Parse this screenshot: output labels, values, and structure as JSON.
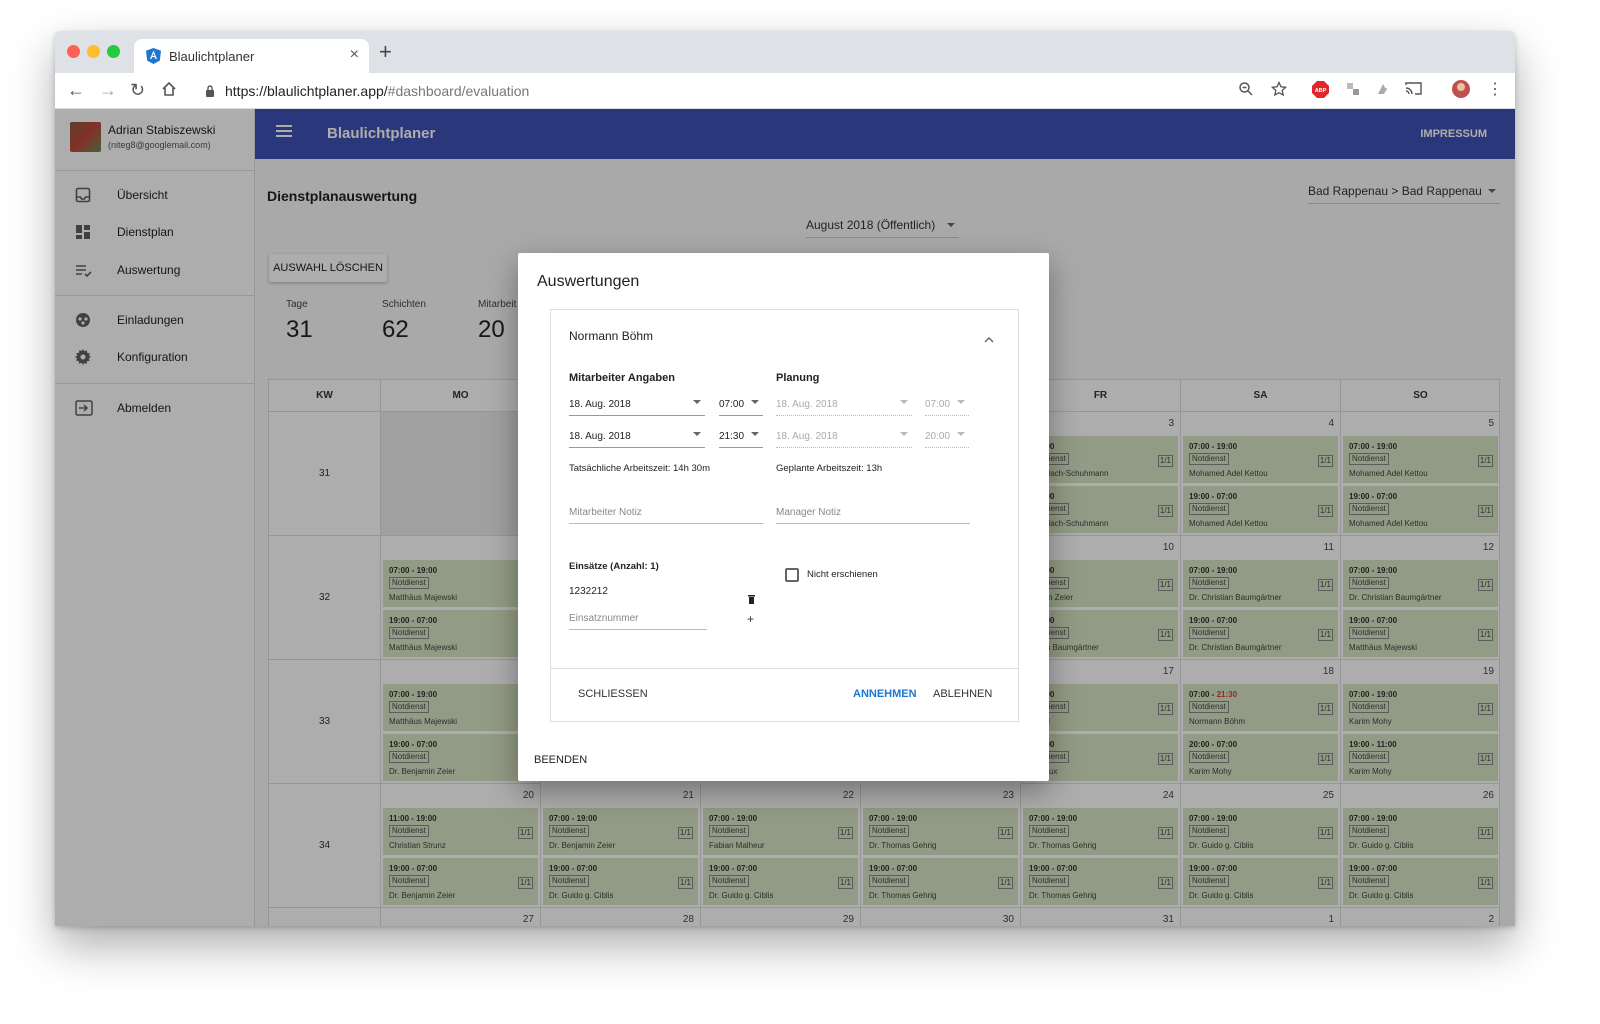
{
  "browser": {
    "tab_title": "Blaulichtplaner",
    "url_host": "https://blaulichtplaner.app/",
    "url_path": "#dashboard/evaluation",
    "new_tab": "+"
  },
  "user": {
    "name": "Adrian Stabiszewski",
    "email": "(niteg8@googlemail.com)"
  },
  "sidebar": {
    "items": [
      {
        "label": "Übersicht",
        "icon": "inbox-icon"
      },
      {
        "label": "Dienstplan",
        "icon": "dashboard-icon"
      },
      {
        "label": "Auswertung",
        "icon": "checklist-icon"
      },
      {
        "label": "Einladungen",
        "icon": "invitations-icon"
      },
      {
        "label": "Konfiguration",
        "icon": "gear-icon"
      },
      {
        "label": "Abmelden",
        "icon": "logout-icon"
      }
    ]
  },
  "appbar": {
    "title": "Blaulichtplaner",
    "impressum": "IMPRESSUM"
  },
  "page": {
    "title": "Dienstplanauswertung",
    "location": "Bad Rappenau > Bad Rappenau",
    "month": "August 2018 (Öffentlich)",
    "clear_button": "AUSWAHL LÖSCHEN",
    "stats": [
      {
        "label": "Tage",
        "value": "31"
      },
      {
        "label": "Schichten",
        "value": "62"
      },
      {
        "label": "Mitarbeit",
        "value": "20"
      }
    ]
  },
  "calendar": {
    "headers": [
      "KW",
      "MO",
      "FR",
      "SA",
      "SO"
    ],
    "weeks": [
      {
        "kw": "31",
        "mo": {
          "day": "",
          "shifts": []
        },
        "fr": {
          "day": "3",
          "shifts": [
            {
              "time": "- 19:00",
              "badge": "Notdienst",
              "count": "1/1",
              "name": "ix Vatlach-Schuhmann"
            },
            {
              "time": "- 07:00",
              "badge": "Notdienst",
              "count": "1/1",
              "name": "ix Vatlach-Schuhmann"
            }
          ]
        },
        "sa": {
          "day": "4",
          "shifts": [
            {
              "time": "07:00 - 19:00",
              "badge": "Notdienst",
              "count": "1/1",
              "name": "Mohamed Adel Kettou"
            },
            {
              "time": "19:00 - 07:00",
              "badge": "Notdienst",
              "count": "1/1",
              "name": "Mohamed Adel Kettou"
            }
          ]
        },
        "so": {
          "day": "5",
          "shifts": [
            {
              "time": "07:00 - 19:00",
              "badge": "Notdienst",
              "count": "1/1",
              "name": "Mohamed Adel Kettou"
            },
            {
              "time": "19:00 - 07:00",
              "badge": "Notdienst",
              "count": "1/1",
              "name": "Mohamed Adel Kettou"
            }
          ]
        }
      },
      {
        "kw": "32",
        "mo": {
          "day": "",
          "shifts": [
            {
              "time": "07:00 - 19:00",
              "badge": "Notdienst",
              "count": "1/1",
              "name": "Matthäus Majewski"
            },
            {
              "time": "19:00 - 07:00",
              "badge": "Notdienst",
              "count": "1/1",
              "name": "Matthäus Majewski"
            }
          ]
        },
        "fr": {
          "day": "10",
          "shifts": [
            {
              "time": "- 19:00",
              "badge": "Notdienst",
              "count": "1/1",
              "name": "njamin Zeier"
            },
            {
              "time": "- 07:00",
              "badge": "Notdienst",
              "count": "1/1",
              "name": "ristian Baumgärtner"
            }
          ]
        },
        "sa": {
          "day": "11",
          "shifts": [
            {
              "time": "07:00 - 19:00",
              "badge": "Notdienst",
              "count": "1/1",
              "name": "Dr. Christian Baumgärtner"
            },
            {
              "time": "19:00 - 07:00",
              "badge": "Notdienst",
              "count": "1/1",
              "name": "Dr. Christian Baumgärtner"
            }
          ]
        },
        "so": {
          "day": "12",
          "shifts": [
            {
              "time": "07:00 - 19:00",
              "badge": "Notdienst",
              "count": "1/1",
              "name": "Dr. Christian Baumgärtner"
            },
            {
              "time": "19:00 - 07:00",
              "badge": "Notdienst",
              "count": "1/1",
              "name": "Matthäus Majewski"
            }
          ]
        }
      },
      {
        "kw": "33",
        "mo": {
          "day": "",
          "shifts": [
            {
              "time": "07:00 - 19:00",
              "badge": "Notdienst",
              "count": "1/1",
              "name": "Matthäus Majewski"
            },
            {
              "time": "19:00 - 07:00",
              "badge": "Notdienst",
              "count": "1/1",
              "name": "Dr. Benjamin Zeier"
            }
          ]
        },
        "fr": {
          "day": "17",
          "shifts": [
            {
              "time": "- 19:00",
              "badge": "Notdienst",
              "count": "1/1",
              "name": "Hubel"
            },
            {
              "time": "- 07:00",
              "badge": "Notdienst",
              "count": "1/1",
              "name": "mut Lux"
            }
          ]
        },
        "sa": {
          "day": "18",
          "shifts": [
            {
              "time": "07:00 - ",
              "late": "21:30",
              "badge": "Notdienst",
              "count": "1/1",
              "name": "Normann Böhm"
            },
            {
              "time": "20:00 - 07:00",
              "badge": "Notdienst",
              "count": "1/1",
              "name": "Karim Mohy"
            }
          ]
        },
        "so": {
          "day": "19",
          "shifts": [
            {
              "time": "07:00 - 19:00",
              "badge": "Notdienst",
              "count": "1/1",
              "name": "Karim Mohy"
            },
            {
              "time": "19:00 - 11:00",
              "badge": "Notdienst",
              "count": "1/1",
              "name": "Karim Mohy"
            }
          ]
        }
      }
    ],
    "week34": {
      "kw": "34",
      "days": [
        {
          "day": "20",
          "shifts": [
            {
              "time": "11:00 - 19:00",
              "badge": "Notdienst",
              "count": "1/1",
              "name": "Christian Strunz"
            },
            {
              "time": "19:00 - 07:00",
              "badge": "Notdienst",
              "count": "1/1",
              "name": "Dr. Benjamin Zeier"
            }
          ]
        },
        {
          "day": "21",
          "shifts": [
            {
              "time": "07:00 - 19:00",
              "badge": "Notdienst",
              "count": "1/1",
              "name": "Dr. Benjamin Zeier"
            },
            {
              "time": "19:00 - 07:00",
              "badge": "Notdienst",
              "count": "1/1",
              "name": "Dr. Guido g. Ciblis"
            }
          ]
        },
        {
          "day": "22",
          "shifts": [
            {
              "time": "07:00 - 19:00",
              "badge": "Notdienst",
              "count": "1/1",
              "name": "Fabian Malheur"
            },
            {
              "time": "19:00 - 07:00",
              "badge": "Notdienst",
              "count": "1/1",
              "name": "Dr. Guido g. Ciblis"
            }
          ]
        },
        {
          "day": "23",
          "shifts": [
            {
              "time": "07:00 - 19:00",
              "badge": "Notdienst",
              "count": "1/1",
              "name": "Dr. Thomas Gehrig"
            },
            {
              "time": "19:00 - 07:00",
              "badge": "Notdienst",
              "count": "1/1",
              "name": "Dr. Thomas Gehrig"
            }
          ]
        },
        {
          "day": "24",
          "shifts": [
            {
              "time": "07:00 - 19:00",
              "badge": "Notdienst",
              "count": "1/1",
              "name": "Dr. Thomas Gehrig"
            },
            {
              "time": "19:00 - 07:00",
              "badge": "Notdienst",
              "count": "1/1",
              "name": "Dr. Thomas Gehrig"
            }
          ]
        },
        {
          "day": "25",
          "shifts": [
            {
              "time": "07:00 - 19:00",
              "badge": "Notdienst",
              "count": "1/1",
              "name": "Dr. Guido g. Ciblis"
            },
            {
              "time": "19:00 - 07:00",
              "badge": "Notdienst",
              "count": "1/1",
              "name": "Dr. Guido g. Ciblis"
            }
          ]
        },
        {
          "day": "26",
          "shifts": [
            {
              "time": "07:00 - 19:00",
              "badge": "Notdienst",
              "count": "1/1",
              "name": "Dr. Guido g. Ciblis"
            },
            {
              "time": "19:00 - 07:00",
              "badge": "Notdienst",
              "count": "1/1",
              "name": "Dr. Guido g. Ciblis"
            }
          ]
        }
      ]
    },
    "week35_days": [
      "27",
      "28",
      "29",
      "30",
      "31",
      "1",
      "2"
    ]
  },
  "dialog": {
    "title": "Auswertungen",
    "employee": "Normann Böhm",
    "col1_title": "Mitarbeiter Angaben",
    "col2_title": "Planung",
    "actual_start_date": "18. Aug. 2018",
    "actual_start_time": "07:00",
    "actual_end_date": "18. Aug. 2018",
    "actual_end_time": "21:30",
    "planned_start_date": "18. Aug. 2018",
    "planned_start_time": "07:00",
    "planned_end_date": "18. Aug. 2018",
    "planned_end_time": "20:00",
    "actual_hours": "Tatsächliche Arbeitszeit: 14h 30m",
    "planned_hours": "Geplante Arbeitszeit: 13h",
    "employee_note_placeholder": "Mitarbeiter Notiz",
    "manager_note_placeholder": "Manager Notiz",
    "deployments_title": "Einsätze (Anzahl: 1)",
    "deployment_number": "1232212",
    "deployment_placeholder": "Einsatznummer",
    "no_show_label": "Nicht erschienen",
    "close_button": "SCHLIESSEN",
    "accept_button": "ANNEHMEN",
    "reject_button": "ABLEHNEN",
    "finish_button": "BEENDEN"
  },
  "colors": {
    "primary": "#3f51b5",
    "accent": "#1976d2",
    "shift_bg": "#d7e5c5",
    "late": "#e53935"
  }
}
